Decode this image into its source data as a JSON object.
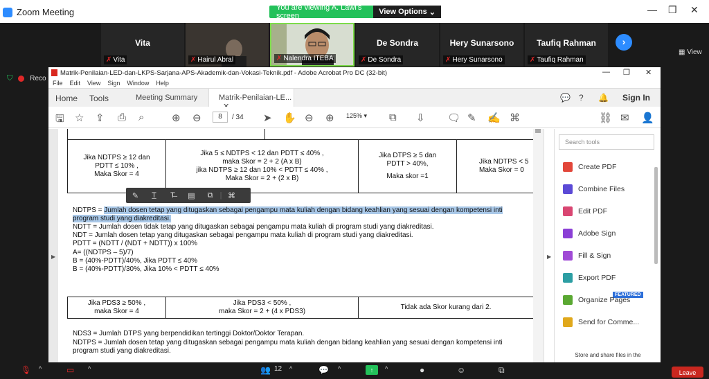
{
  "zoom": {
    "title": "Zoom Meeting",
    "share_banner": "You are viewing A. Lawi's screen",
    "view_options": "View Options",
    "view_label": "View",
    "recording": "Reco",
    "participants_count": "12",
    "leave": "Leave",
    "gallery": [
      {
        "big": "Vita",
        "label": "Vita"
      },
      {
        "big": "",
        "label": "Hairul Abral"
      },
      {
        "big": "",
        "label": "Nalendra ITEBA"
      },
      {
        "big": "De Sondra",
        "label": "De Sondra"
      },
      {
        "big": "Hery Sunarsono",
        "label": "Hery Sunarsono"
      },
      {
        "big": "Taufiq Rahman",
        "label": "Taufiq Rahman"
      }
    ]
  },
  "acrobat": {
    "title": "Matrik-Penilaian-LED-dan-LKPS-Sarjana-APS-Akademik-dan-Vokasi-Teknik.pdf - Adobe Acrobat Pro DC (32-bit)",
    "menu": [
      "File",
      "Edit",
      "View",
      "Sign",
      "Window",
      "Help"
    ],
    "tabs": {
      "home": "Home",
      "tools": "Tools",
      "meeting": "Meeting Summary",
      "active": "Matrik-Penilaian-LE..."
    },
    "sign_in": "Sign In",
    "page_current": "8",
    "page_total": "/ 34",
    "zoom_level": "125%",
    "search_tools_placeholder": "Search tools",
    "tools": [
      {
        "label": "Create PDF",
        "color": "#e2463a"
      },
      {
        "label": "Combine Files",
        "color": "#5b4ad6"
      },
      {
        "label": "Edit PDF",
        "color": "#d94672"
      },
      {
        "label": "Adobe Sign",
        "color": "#8b3fd6"
      },
      {
        "label": "Fill & Sign",
        "color": "#a04ad6"
      },
      {
        "label": "Export PDF",
        "color": "#2c9ea3"
      },
      {
        "label": "Organize Pages",
        "color": "#5aa832"
      },
      {
        "label": "Send for Comme...",
        "color": "#e0a81c"
      }
    ],
    "featured": "FEATURED",
    "panel_footer": "Store and share files in the"
  },
  "doc": {
    "row1": {
      "c1": [
        "Jika NDTPS ≥ 12 dan",
        "PDTT ≤ 10% ,",
        "Maka Skor = 4"
      ],
      "c2": [
        "Jika 5 ≤ NDTPS < 12 dan PDTT ≤ 40% ,",
        "maka Skor = 2 + 2 (A x B)",
        "jika NDTPS ≥ 12 dan 10% < PDTT ≤ 40% ,",
        "Maka Skor = 2 + (2 x B)"
      ],
      "c3": [
        "Jika DTPS ≥ 5 dan",
        "PDTT > 40%,",
        "",
        "Maka skor =1"
      ],
      "c4": [
        "Jika NDTPS < 5",
        "Maka Skor = 0"
      ]
    },
    "para1": {
      "l1_prefix": "NDTPS = ",
      "l1_hl": "Jumlah dosen tetap yang ditugaskan sebagai pengampu mata kuliah dengan bidang keahlian yang sesuai dengan kompetensi inti",
      "l2_hl": "program studi yang diakreditasi.",
      "lines": [
        "NDTT = Jumlah dosen tidak tetap yang ditugaskan sebagai pengampu mata kuliah di program studi yang diakreditasi.",
        "NDT = Jumlah dosen tetap yang ditugaskan sebagai pengampu mata kuliah di program studi yang diakreditasi.",
        "PDTT = (NDTT / (NDT + NDTT)) x 100%",
        "A= ((NDTPS – 5)/7)",
        "B = (40%-PDTT)/40%, Jika PDTT ≤ 40%",
        "B = (40%-PDTT)/30%, Jika 10% < PDTT ≤ 40%"
      ]
    },
    "row2": {
      "c1": [
        "Jika PDS3 ≥ 50% ,",
        "maka Skor = 4"
      ],
      "c2": [
        "Jika PDS3 < 50% ,",
        "maka Skor = 2 + (4 x PDS3)"
      ],
      "c3": [
        "Tidak ada Skor kurang dari 2."
      ]
    },
    "para2": [
      "NDS3 = Jumlah DTPS yang berpendidikan tertinggi Doktor/Doktor Terapan.",
      "NDTPS = Jumlah dosen tetap yang ditugaskan sebagai pengampu mata kuliah dengan bidang keahlian yang sesuai dengan kompetensi inti",
      "program studi yang diakreditasi."
    ]
  }
}
